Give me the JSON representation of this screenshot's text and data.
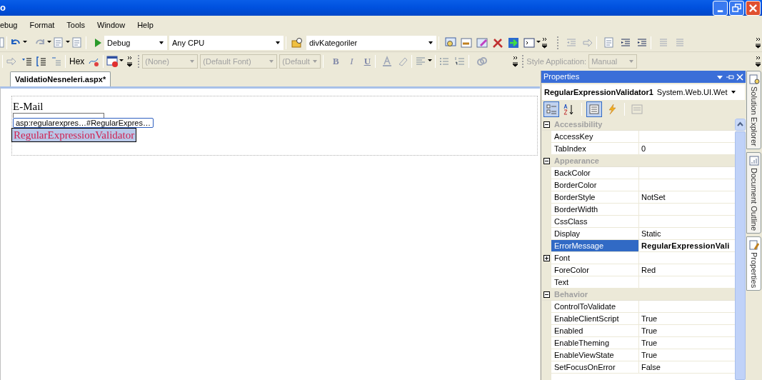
{
  "window": {
    "title": "o"
  },
  "menu": [
    "ebug",
    "Format",
    "Tools",
    "Window",
    "Help"
  ],
  "toolbar_1": {
    "configuration": {
      "value": "Debug"
    },
    "platform": {
      "value": "Any CPU"
    },
    "find": {
      "value": "divKategoriler"
    }
  },
  "toolbar_2": {
    "hex": "Hex",
    "block_format": {
      "value": "(None)",
      "disabled": true
    },
    "font_name": {
      "value": "(Default Font)",
      "disabled": true
    },
    "font_size": {
      "value": "(Default",
      "disabled": true
    },
    "bold": "B",
    "italic": "I",
    "underline": "U",
    "style_application_label": "Style Application:",
    "style_application": {
      "value": "Manual",
      "disabled": true
    }
  },
  "tabs": [
    {
      "label": "ValidatioNesneleri.aspx*",
      "selected": true
    }
  ],
  "designer": {
    "label": "E-Mail",
    "smart_tag": "asp:regularexpres…#RegularExpres…",
    "validator": {
      "text": "RegularExpressionValidator",
      "selected": true
    }
  },
  "properties": {
    "title": "Properties",
    "object_name": "RegularExpressionValidator1",
    "object_type": "System.Web.UI.Wet",
    "view_buttons": [
      {
        "kind": "categorized",
        "selected": true
      },
      {
        "kind": "alphabetical",
        "selected": false
      },
      {
        "kind": "properties",
        "selected": true
      },
      {
        "kind": "events",
        "selected": false
      },
      {
        "kind": "pages",
        "selected": false
      }
    ],
    "rows": [
      {
        "kind": "category",
        "name": "Accessibility",
        "expanded": true
      },
      {
        "kind": "property",
        "name": "AccessKey",
        "selected": false
      },
      {
        "kind": "property",
        "name": "TabIndex",
        "value": "0",
        "selected": false,
        "modified": false
      },
      {
        "kind": "category",
        "name": "Appearance",
        "expanded": true
      },
      {
        "kind": "property",
        "name": "BackColor",
        "selected": false
      },
      {
        "kind": "property",
        "name": "BorderColor",
        "selected": false
      },
      {
        "kind": "property",
        "name": "BorderStyle",
        "value": "NotSet",
        "selected": false,
        "modified": false
      },
      {
        "kind": "property",
        "name": "BorderWidth",
        "selected": false
      },
      {
        "kind": "property",
        "name": "CssClass",
        "selected": false
      },
      {
        "kind": "property",
        "name": "Display",
        "value": "Static",
        "selected": false,
        "modified": false
      },
      {
        "kind": "property",
        "name": "ErrorMessage",
        "value": "RegularExpressionVali",
        "selected": true,
        "modified": true
      },
      {
        "kind": "group",
        "name": "Font",
        "expanded": false
      },
      {
        "kind": "property",
        "name": "ForeColor",
        "value": "Red",
        "selected": false,
        "modified": false
      },
      {
        "kind": "property",
        "name": "Text",
        "selected": false
      },
      {
        "kind": "category",
        "name": "Behavior",
        "expanded": true
      },
      {
        "kind": "property",
        "name": "ControlToValidate",
        "selected": false
      },
      {
        "kind": "property",
        "name": "EnableClientScript",
        "value": "True",
        "selected": false,
        "modified": false
      },
      {
        "kind": "property",
        "name": "Enabled",
        "value": "True",
        "selected": false,
        "modified": false
      },
      {
        "kind": "property",
        "name": "EnableTheming",
        "value": "True",
        "selected": false,
        "modified": false
      },
      {
        "kind": "property",
        "name": "EnableViewState",
        "value": "True",
        "selected": false,
        "modified": false
      },
      {
        "kind": "property",
        "name": "SetFocusOnError",
        "value": "False",
        "selected": false,
        "modified": false
      }
    ]
  },
  "side_tabs": [
    {
      "label": "Solution Explorer",
      "selected": false
    },
    {
      "label": "Document Outline",
      "selected": false
    },
    {
      "label": "Properties",
      "selected": true
    }
  ]
}
